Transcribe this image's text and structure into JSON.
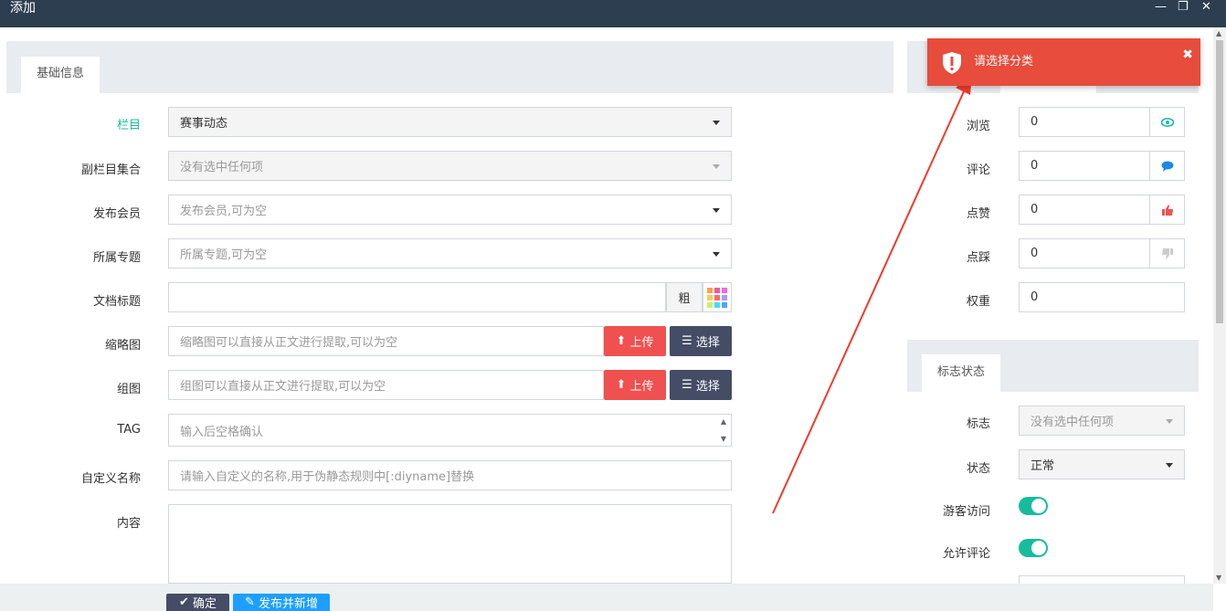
{
  "window": {
    "title": "添加",
    "min": "—",
    "max": "❐",
    "close": "✕"
  },
  "basic": {
    "tab": "基础信息",
    "fields": {
      "category": {
        "label": "栏目",
        "value": "赛事动态"
      },
      "subcategory": {
        "label": "副栏目集合",
        "value": "没有选中任何项"
      },
      "member": {
        "label": "发布会员",
        "placeholder": "发布会员,可为空"
      },
      "special": {
        "label": "所属专题",
        "placeholder": "所属专题,可为空"
      },
      "doctitle": {
        "label": "文档标题",
        "value": "",
        "bold": "粗"
      },
      "thumb": {
        "label": "缩略图",
        "placeholder": "缩略图可以直接从正文进行提取,可以为空",
        "upload": "上传",
        "select": "选择"
      },
      "images": {
        "label": "组图",
        "placeholder": "组图可以直接从正文进行提取,可以为空",
        "upload": "上传",
        "select": "选择"
      },
      "tag": {
        "label": "TAG",
        "placeholder": "输入后空格确认"
      },
      "diyname": {
        "label": "自定义名称",
        "placeholder": "请输入自定义的名称,用于伪静态规则中[:diyname]替换"
      },
      "content": {
        "label": "内容",
        "value": ""
      }
    }
  },
  "stats": {
    "views": {
      "label": "浏览",
      "value": "0"
    },
    "comments": {
      "label": "评论",
      "value": "0"
    },
    "likes": {
      "label": "点赞",
      "value": "0"
    },
    "dislikes": {
      "label": "点踩",
      "value": "0"
    },
    "weight": {
      "label": "权重",
      "value": "0"
    }
  },
  "status": {
    "tab": "标志状态",
    "flag": {
      "label": "标志",
      "value": "没有选中任何项"
    },
    "state": {
      "label": "状态",
      "value": "正常"
    },
    "guest": {
      "label": "游客访问",
      "on": true
    },
    "allow_comment": {
      "label": "允许评论",
      "on": true
    }
  },
  "footer": {
    "confirm": "确定",
    "publish": "发布并新增"
  },
  "toast": {
    "message": "请选择分类"
  },
  "colors": {
    "primary": "#18bc9c",
    "danger": "#e74c3c",
    "header": "#2c3e50"
  }
}
